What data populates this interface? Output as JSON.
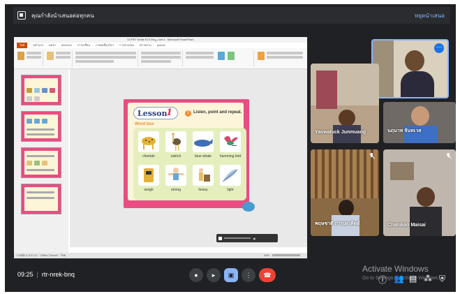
{
  "banner": {
    "title": "คุณกำลังนำเสนอต่อทุกคน",
    "stop_label": "หยุดนำเสนอ"
  },
  "powerpoint": {
    "title": "03 PET Smile ELS Eng_Unit 4 - Microsoft PowerPoint",
    "file_tab": "ไฟล์",
    "tabs": [
      "หน้าแรก",
      "แทรก",
      "ออกแบบ",
      "การเปลี่ยน",
      "ภาพเคลื่อนไหว",
      "การนำเสนอ",
      "ตรวจทาน",
      "มุมมอง"
    ],
    "status_left": "ภาพนิ่ง 3 จาก 21 · \"Office Theme\" · ไทย",
    "status_zoom": "39%"
  },
  "slide": {
    "lesson_label": "Lesson",
    "lesson_number": "1",
    "instruction_number": "1",
    "instruction": "Listen, point and repeat.",
    "section": "Word box",
    "words": [
      "cheetah",
      "ostrich",
      "blue whale",
      "humming bird",
      "weigh",
      "strong",
      "heavy",
      "light"
    ]
  },
  "participants": [
    {
      "name": "Yaowaluck Junmuang"
    },
    {
      "name": "นฤนาท จันทเวส"
    },
    {
      "name": "พฤษชาติ การเผาคิตต์"
    },
    {
      "name": "Chanikan Maisai"
    }
  ],
  "controls": {
    "time": "09:25",
    "meeting_code": "rtr-nrek-bnq",
    "mic_icon": "mic-icon",
    "camera_icon": "camera-icon",
    "present_icon": "present-icon",
    "more_icon": "more-vert-icon",
    "hangup_icon": "call-end-icon"
  },
  "watermark": {
    "line1": "Activate Windows",
    "line2": "Go to Settings to activate Windows."
  },
  "colors": {
    "meet_bg": "#202124",
    "slide_border": "#e94d82",
    "accent_blue": "#8ab4f8",
    "hangup_red": "#ea4335"
  }
}
